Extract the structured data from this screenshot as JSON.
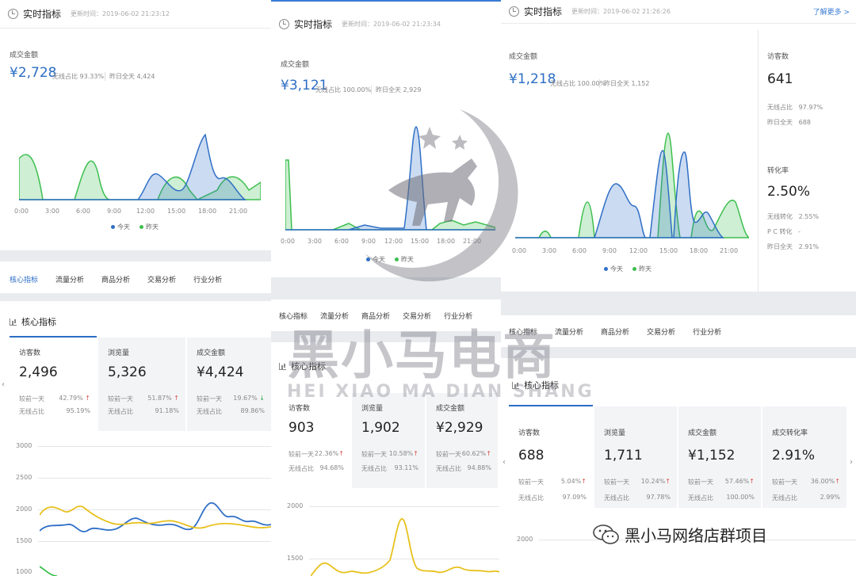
{
  "panel1": {
    "header": {
      "title": "实时指标",
      "update_time": "更新时间：2019-06-02 21:23:12"
    },
    "metric": {
      "label": "成交金额",
      "value": "¥2,728",
      "wireless": "无线占比 93.33%",
      "yesterday": "昨日全天 4,424"
    },
    "x_ticks": [
      "0:00",
      "3:00",
      "6:00",
      "9:00",
      "12:00",
      "15:00",
      "18:00",
      "21:00"
    ],
    "legend": {
      "today": "今天",
      "yesterday": "昨天"
    },
    "tabs": [
      "核心指标",
      "流量分析",
      "商品分析",
      "交易分析",
      "行业分析"
    ],
    "section_title": "核心指标",
    "cards": [
      {
        "title": "访客数",
        "value": "2,496",
        "r1_label": "较前一天",
        "r1_val": "42.79%",
        "r1_dir": "↑",
        "r2_label": "无线占比",
        "r2_val": "95.19%"
      },
      {
        "title": "浏览量",
        "value": "5,326",
        "r1_label": "较前一天",
        "r1_val": "51.87%",
        "r1_dir": "↑",
        "r2_label": "无线占比",
        "r2_val": "91.18%"
      },
      {
        "title": "成交金额",
        "value": "¥4,424",
        "r1_label": "较前一天",
        "r1_val": "19.67%",
        "r1_dir": "↓",
        "r2_label": "无线占比",
        "r2_val": "89.86%"
      }
    ],
    "y_ticks": [
      "3000",
      "2500",
      "2000",
      "1500",
      "1000"
    ]
  },
  "panel2": {
    "header": {
      "title": "实时指标",
      "update_time": "更新时间：2019-06-02 21:23:34"
    },
    "metric": {
      "label": "成交金额",
      "value": "¥3,121",
      "wireless": "无线占比 100.00%",
      "yesterday": "昨日全天 2,929"
    },
    "x_ticks": [
      "0:00",
      "3:00",
      "6:00",
      "9:00",
      "12:00",
      "15:00",
      "18:00",
      "21:00"
    ],
    "legend": {
      "today": "今天",
      "yesterday": "昨天"
    },
    "tabs": [
      "核心指标",
      "流量分析",
      "商品分析",
      "交易分析",
      "行业分析"
    ],
    "section_title": "核心指标",
    "cards": [
      {
        "title": "访客数",
        "value": "903",
        "r1_label": "较前一天",
        "r1_val": "22.36%",
        "r1_dir": "↑",
        "r2_label": "无线占比",
        "r2_val": "94.68%"
      },
      {
        "title": "浏览量",
        "value": "1,902",
        "r1_label": "较前一天",
        "r1_val": "10.58%",
        "r1_dir": "↑",
        "r2_label": "无线占比",
        "r2_val": "93.11%"
      },
      {
        "title": "成交金额",
        "value": "¥2,929",
        "r1_label": "较前一天",
        "r1_val": "60.62%",
        "r1_dir": "↑",
        "r2_label": "无线占比",
        "r2_val": "94.88%"
      }
    ],
    "y_ticks": [
      "2000",
      "1500"
    ]
  },
  "panel3": {
    "header": {
      "title": "实时指标",
      "update_time": "更新时间：2019-06-02 21:26:26",
      "more": "了解更多 >"
    },
    "metric": {
      "label": "成交金额",
      "value": "¥1,218",
      "wireless": "无线占比 100.00%",
      "yesterday": "昨日全天 1,152"
    },
    "x_ticks": [
      "0:00",
      "3:00",
      "6:00",
      "9:00",
      "12:00",
      "15:00",
      "18:00",
      "21:00"
    ],
    "legend": {
      "today": "今天",
      "yesterday": "昨天"
    },
    "side": {
      "visitors_label": "访客数",
      "visitors_value": "641",
      "v_wireless": "无线占比",
      "v_wireless_val": "97.97%",
      "v_yesterday": "昨日全天",
      "v_yesterday_val": "688",
      "conv_label": "转化率",
      "conv_value": "2.50%",
      "c_wireless": "无线转化",
      "c_wireless_val": "2.55%",
      "c_pc": "P C 转化",
      "c_pc_val": "-",
      "c_yesterday": "昨日全天",
      "c_yesterday_val": "2.91%"
    },
    "tabs": [
      "核心指标",
      "流量分析",
      "商品分析",
      "交易分析",
      "行业分析"
    ],
    "section_title": "核心指标",
    "cards": [
      {
        "title": "访客数",
        "value": "688",
        "r1_label": "较前一天",
        "r1_val": "5.04%",
        "r1_dir": "↑",
        "r2_label": "无线占比",
        "r2_val": "97.09%"
      },
      {
        "title": "浏览量",
        "value": "1,711",
        "r1_label": "较前一天",
        "r1_val": "10.24%",
        "r1_dir": "↑",
        "r2_label": "无线占比",
        "r2_val": "97.78%"
      },
      {
        "title": "成交金额",
        "value": "¥1,152",
        "r1_label": "较前一天",
        "r1_val": "57.46%",
        "r1_dir": "↑",
        "r2_label": "无线占比",
        "r2_val": "100.00%"
      },
      {
        "title": "成交转化率",
        "value": "2.91%",
        "r1_label": "较前一天",
        "r1_val": "36.00%",
        "r1_dir": "↑",
        "r2_label": "无线占比",
        "r2_val": "2.99%"
      }
    ],
    "y_ticks": [
      "2000"
    ]
  },
  "watermark": {
    "cn": "黑小马电商",
    "en": "HEI XIAO MA DIAN SHANG",
    "corner": "黑小马网络店群项目"
  },
  "colors": {
    "today": "#2f6fc6",
    "yesterday": "#3dbf4f",
    "accent": "#2c6dc4",
    "up": "#d9534f",
    "down": "#3aa655",
    "line_yellow": "#e8c11e"
  }
}
